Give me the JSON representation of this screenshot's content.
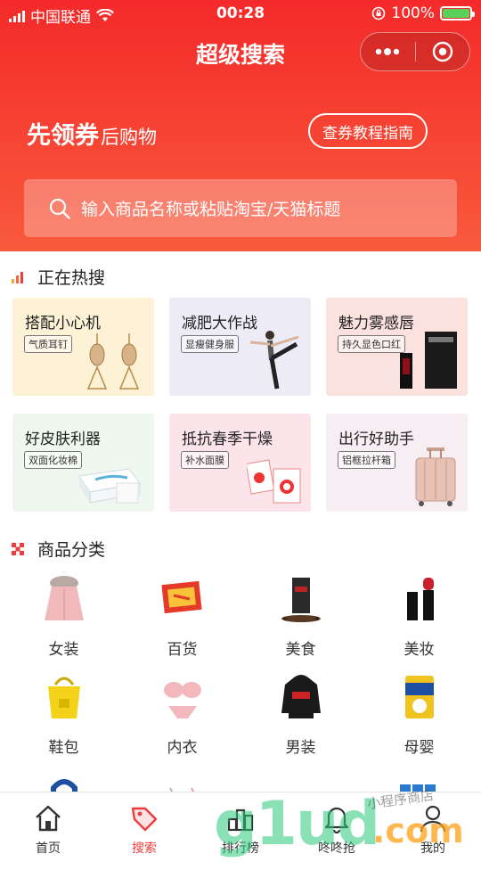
{
  "status": {
    "carrier": "中国联通",
    "time": "00:28",
    "battery": "100%",
    "battery_level": 1.0
  },
  "nav": {
    "title": "超级搜索",
    "more_icon": "more-dots-icon",
    "close_icon": "target-circle-icon"
  },
  "hero": {
    "slogan_big": "先领券",
    "slogan_small": "后购物",
    "guide_button": "查券教程指南"
  },
  "search": {
    "placeholder": "输入商品名称或粘贴淘宝/天猫标题",
    "icon": "search-icon"
  },
  "hot": {
    "title": "正在热搜",
    "cards": [
      {
        "title": "搭配小心机",
        "tag": "气质耳钉",
        "bg": "#fdf1d6"
      },
      {
        "title": "减肥大作战",
        "tag": "显瘦健身服",
        "bg": "#ecebf6"
      },
      {
        "title": "魅力雾感唇",
        "tag": "持久显色口红",
        "bg": "#fbe2df"
      },
      {
        "title": "好皮肤利器",
        "tag": "双面化妆棉",
        "bg": "#eef8ef"
      },
      {
        "title": "抵抗春季干燥",
        "tag": "补水面膜",
        "bg": "#fbe4ea"
      },
      {
        "title": "出行好助手",
        "tag": "铝框拉杆箱",
        "bg": "#f7eef4"
      }
    ]
  },
  "categories": {
    "title": "商品分类",
    "items": [
      {
        "label": "女装",
        "icon": "coat-icon"
      },
      {
        "label": "百货",
        "icon": "household-icon"
      },
      {
        "label": "美食",
        "icon": "coffee-bag-icon"
      },
      {
        "label": "美妆",
        "icon": "lipstick-icon"
      },
      {
        "label": "鞋包",
        "icon": "tote-bag-icon"
      },
      {
        "label": "内衣",
        "icon": "lingerie-icon"
      },
      {
        "label": "男装",
        "icon": "hoodie-icon"
      },
      {
        "label": "母婴",
        "icon": "formula-can-icon"
      }
    ]
  },
  "tabbar": {
    "items": [
      {
        "label": "首页",
        "icon": "home-icon"
      },
      {
        "label": "搜索",
        "icon": "price-tag-icon"
      },
      {
        "label": "排行榜",
        "icon": "ranking-icon"
      },
      {
        "label": "咚咚抢",
        "icon": "bell-icon"
      },
      {
        "label": "我的",
        "icon": "user-icon"
      }
    ],
    "active": "搜索"
  },
  "watermark": {
    "main": "g1ud",
    "cn": "小程序商店",
    "dot": ".com"
  },
  "colors": {
    "brand": "#f42a2a",
    "active_tab": "#f03c3c"
  }
}
